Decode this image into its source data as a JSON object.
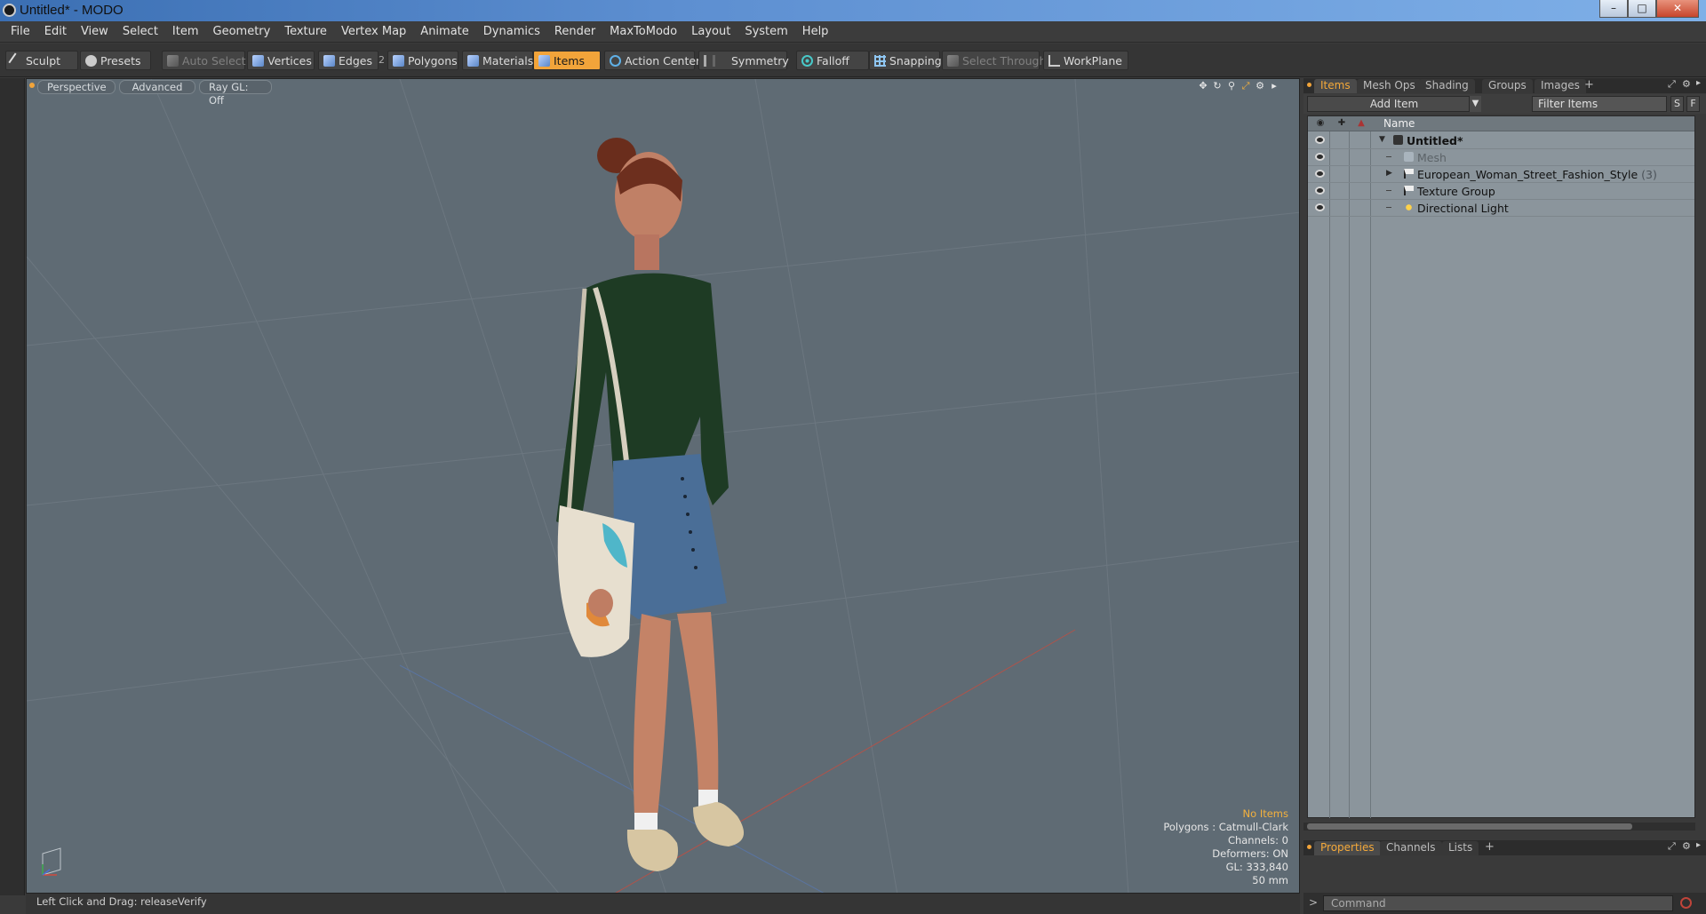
{
  "window": {
    "title": "Untitled* - MODO"
  },
  "menu": [
    "File",
    "Edit",
    "View",
    "Select",
    "Item",
    "Geometry",
    "Texture",
    "Vertex Map",
    "Animate",
    "Dynamics",
    "Render",
    "MaxToModo",
    "Layout",
    "System",
    "Help"
  ],
  "toolbar": {
    "sculpt": "Sculpt",
    "presets": "Presets",
    "auto_select": "Auto Select",
    "vertices": "Vertices",
    "edges": "Edges",
    "edges_count": "2",
    "polygons": "Polygons",
    "materials": "Materials",
    "items": "Items",
    "action_center": "Action Center",
    "symmetry": "Symmetry",
    "falloff": "Falloff",
    "snapping": "Snapping",
    "select_through": "Select Through",
    "workplane": "WorkPlane"
  },
  "viewport": {
    "view": "Perspective",
    "mode": "Advanced",
    "raygl": "Ray GL: Off",
    "hud": {
      "selection": "No Items",
      "polygons": "Polygons : Catmull-Clark",
      "channels": "Channels: 0",
      "deformers": "Deformers: ON",
      "gl": "GL: 333,840",
      "focal": "50 mm"
    },
    "status": "Left Click and Drag:  releaseVerify"
  },
  "items_panel": {
    "tabs": [
      "Items",
      "Mesh Ops",
      "Shading",
      "Groups",
      "Images"
    ],
    "add_item": "Add Item",
    "filter_placeholder": "Filter Items",
    "btn_s": "S",
    "btn_f": "F",
    "column_name": "Name",
    "rows": [
      {
        "label": "Untitled*",
        "count": ""
      },
      {
        "label": "Mesh",
        "count": ""
      },
      {
        "label": "European_Woman_Street_Fashion_Style",
        "count": "(3)"
      },
      {
        "label": "Texture Group",
        "count": ""
      },
      {
        "label": "Directional Light",
        "count": ""
      }
    ]
  },
  "bottom_panel": {
    "tabs": [
      "Properties",
      "Channels",
      "Lists"
    ],
    "command_placeholder": "Command"
  },
  "colors": {
    "accent": "#f2a43a",
    "viewport_bg": "#5f6b74",
    "tree_bg": "#8b959c"
  }
}
